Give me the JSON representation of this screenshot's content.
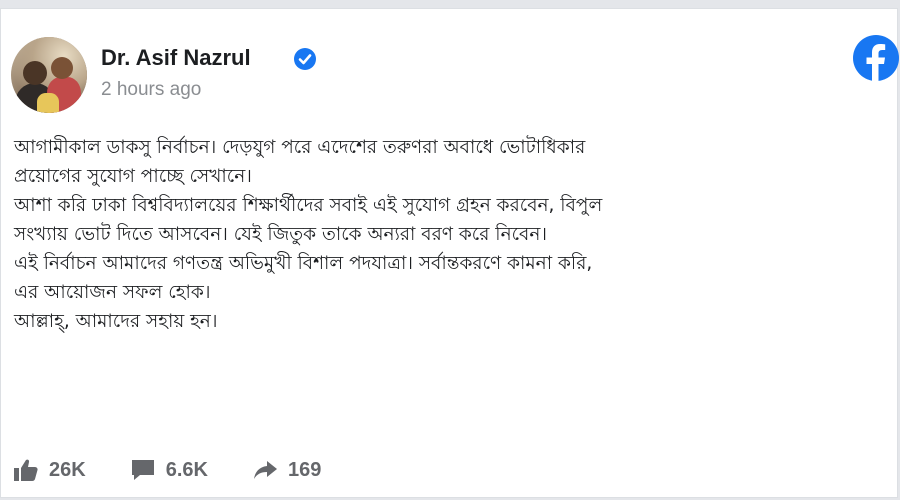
{
  "post": {
    "author_name": "Dr. Asif Nazrul",
    "timestamp": "2 hours ago",
    "lines": [
      "আগামীকাল ডাকসু নির্বাচন। দেড়যুগ পরে এদেশের তরুণরা অবাধে ভোটাধিকার",
      "প্রয়োগের সুযোগ পাচ্ছে সেখানে।",
      "আশা করি ঢাকা বিশ্ববিদ্যালয়ের শিক্ষার্থীদের সবাই এই সুযোগ গ্রহন করবেন, বিপুল",
      "সংখ্যায় ভোট দিতে আসবেন। যেই জিতুক তাকে অন্যরা বরণ করে নিবেন।",
      "এই নির্বাচন আমাদের গণতন্ত্র অভিমুখী বিশাল পদযাত্রা। সর্বান্তকরণে কামনা করি,",
      "এর আয়োজন সফল হোক।",
      "আল্লাহ্‌, আমাদের সহায় হন।"
    ]
  },
  "stats": {
    "likes": "26K",
    "comments": "6.6K",
    "shares": "169"
  },
  "icons": {
    "verified": "verified-badge-icon",
    "platform": "facebook-logo-icon",
    "like": "thumbs-up-icon",
    "comment": "comment-bubble-icon",
    "share": "share-arrow-icon"
  },
  "colors": {
    "facebook_blue": "#1877f2",
    "text_primary": "#1c1e21",
    "text_secondary": "#65676b"
  }
}
